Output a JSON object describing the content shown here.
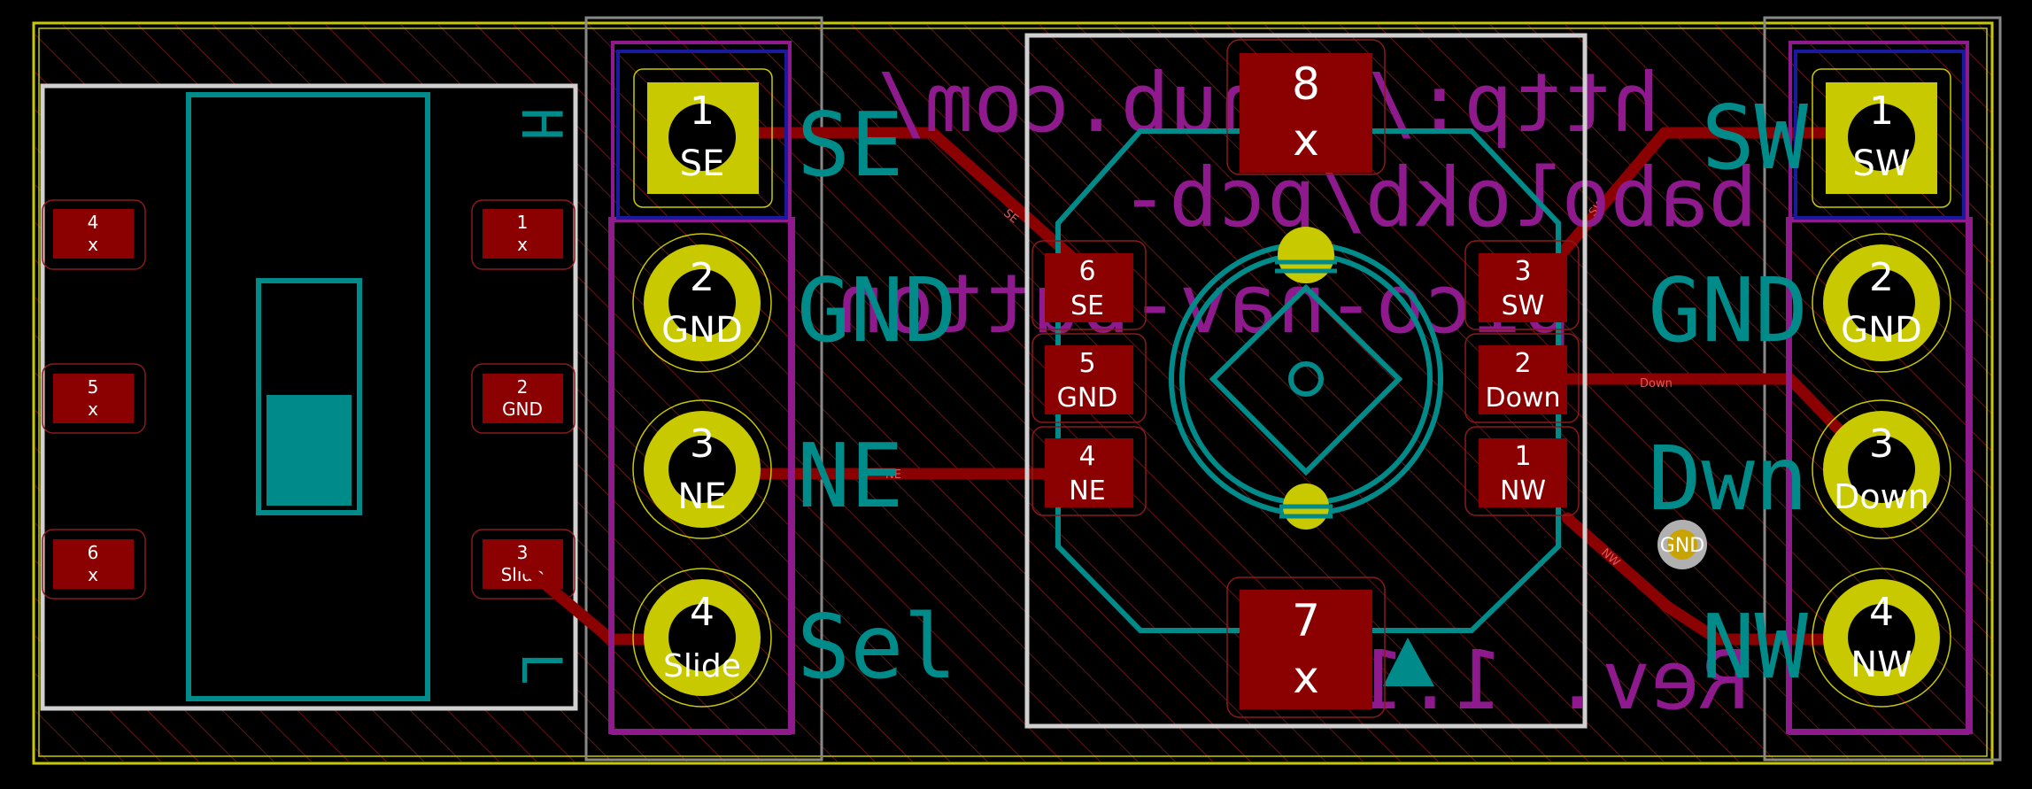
{
  "slide_switch": {
    "pads": [
      {
        "num": "4",
        "net": "x"
      },
      {
        "num": "5",
        "net": "x"
      },
      {
        "num": "6",
        "net": "x"
      },
      {
        "num": "1",
        "net": "x"
      },
      {
        "num": "2",
        "net": "GND"
      },
      {
        "num": "3",
        "net": "Slide"
      }
    ],
    "marks": {
      "high": "H",
      "low": "L"
    }
  },
  "left_header": {
    "pins": [
      {
        "num": "1",
        "net": "SE"
      },
      {
        "num": "2",
        "net": "GND"
      },
      {
        "num": "3",
        "net": "NE"
      },
      {
        "num": "4",
        "net": "Slide"
      }
    ],
    "labels": [
      "SE",
      "GND",
      "NE",
      "Sel"
    ]
  },
  "nav_button": {
    "pads": [
      {
        "num": "8",
        "net": "x"
      },
      {
        "num": "7",
        "net": "x"
      },
      {
        "num": "6",
        "net": "SE"
      },
      {
        "num": "5",
        "net": "GND"
      },
      {
        "num": "4",
        "net": "NE"
      },
      {
        "num": "3",
        "net": "SW"
      },
      {
        "num": "2",
        "net": "Down"
      },
      {
        "num": "1",
        "net": "NW"
      }
    ]
  },
  "right_header": {
    "pins": [
      {
        "num": "1",
        "net": "SW"
      },
      {
        "num": "2",
        "net": "GND"
      },
      {
        "num": "3",
        "net": "Down"
      },
      {
        "num": "4",
        "net": "NW"
      }
    ],
    "labels": [
      "SW",
      "GND",
      "Dwn",
      "NW"
    ]
  },
  "fab_text": {
    "line1": "http://gnub.com/",
    "line2": "babolokb/pcb-",
    "line3": "pico-nav-button",
    "rev": "Rev. 1.1"
  },
  "trace_labels": [
    "SE",
    "SW",
    "NE",
    "Down",
    "NW"
  ],
  "via_label": "GND",
  "colors": {
    "background": "#000000",
    "copper": "#8b0000",
    "pad_fill": "#c9c900",
    "silkscreen": "#008b8b",
    "fabrication": "#8e1a8e",
    "courtyard": "#d0d0d0",
    "edge_cuts": "#c8c800"
  }
}
